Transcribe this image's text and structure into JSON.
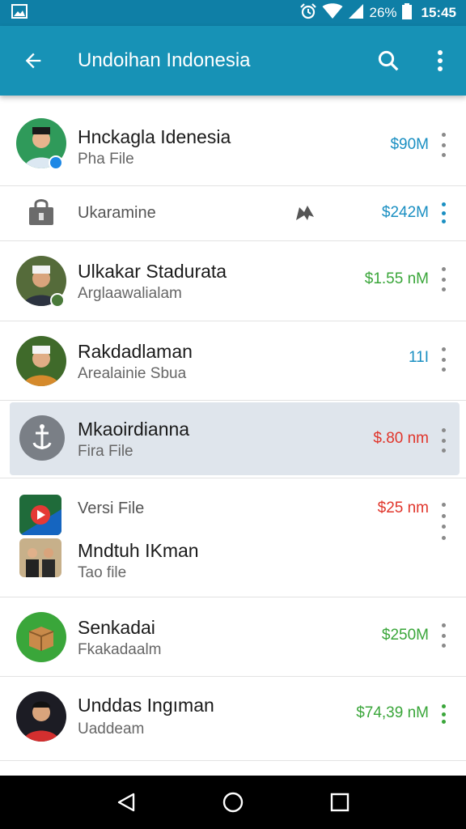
{
  "status": {
    "battery": "26%",
    "time": "15:45"
  },
  "header": {
    "title": "Undoihan Indonesia"
  },
  "icons": {
    "back": "arrow-back-icon",
    "search": "search-icon",
    "menu": "more-vert-icon"
  },
  "colors": {
    "app_bar": "#1792b6",
    "status_bar": "#0f7fa6",
    "blue": "#1a8fc2",
    "green": "#3aa63a",
    "red": "#e0352b"
  },
  "items": [
    {
      "name": "Hnckagla Idenesia",
      "sub": "Pha File",
      "amount": "$90M"
    },
    {
      "name": "Ukaramine",
      "amount": "$242M"
    },
    {
      "name": "Ulkakar Stadurata",
      "sub": "Arglaawalialam",
      "amount": "$1.55 nM"
    },
    {
      "name": "Rakdadlaman",
      "sub": "Arealainie Sbua",
      "amount": "11I"
    },
    {
      "name": "Mkaoirdianna",
      "sub": "Fira File",
      "amount": "$.80 nm"
    },
    {
      "name": "Versi File",
      "amount": "$25 nm",
      "name2": "Mndtuh IKman",
      "sub2": "Tao file"
    },
    {
      "name": "Senkadai",
      "sub": "Fkakadaalm",
      "amount": "$250M"
    },
    {
      "name": "Unddas Ingıman",
      "sub": "Uaddeam",
      "amount": "$74,39 nM"
    }
  ]
}
